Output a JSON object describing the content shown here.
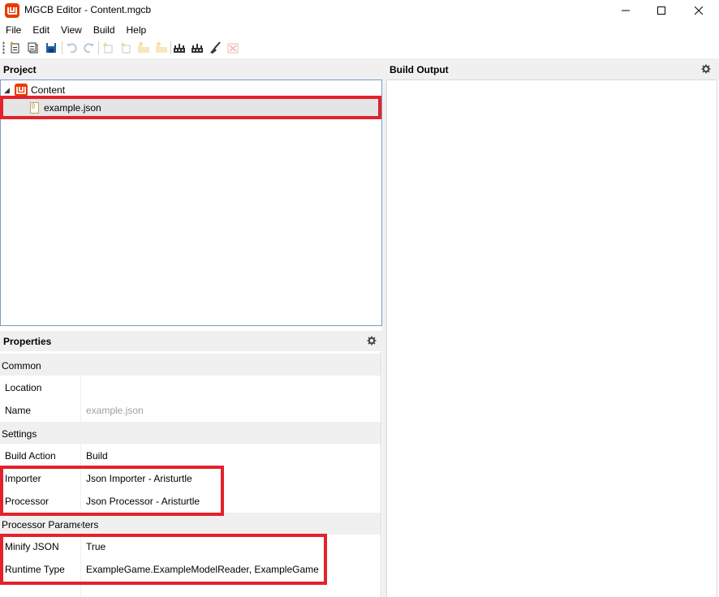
{
  "window": {
    "title": "MGCB Editor - Content.mgcb",
    "logo": "monogame-logo",
    "controls": {
      "minimize": "—",
      "maximize": "☐",
      "close": "✕"
    }
  },
  "menu": [
    "File",
    "Edit",
    "View",
    "Build",
    "Help"
  ],
  "toolbar": {
    "buttons": [
      {
        "name": "new-icon",
        "enabled": true
      },
      {
        "name": "open-icon",
        "enabled": true
      },
      {
        "name": "save-icon",
        "enabled": true
      },
      {
        "name": "undo-icon",
        "enabled": false
      },
      {
        "name": "redo-icon",
        "enabled": false
      },
      {
        "name": "add-new-item-icon",
        "enabled": false
      },
      {
        "name": "add-existing-item-icon",
        "enabled": false
      },
      {
        "name": "add-new-folder-icon",
        "enabled": false
      },
      {
        "name": "add-existing-folder-icon",
        "enabled": false
      },
      {
        "name": "build-icon",
        "enabled": true
      },
      {
        "name": "rebuild-icon",
        "enabled": true
      },
      {
        "name": "clean-icon",
        "enabled": true
      },
      {
        "name": "cancel-build-icon",
        "enabled": false
      }
    ]
  },
  "project": {
    "header": "Project",
    "root_label": "Content",
    "items": [
      {
        "label": "example.json",
        "icon": "json-file-icon",
        "selected": true
      }
    ]
  },
  "build_output": {
    "header": "Build Output"
  },
  "properties": {
    "header": "Properties",
    "categories": [
      {
        "label": "Common",
        "rows": [
          {
            "name": "Location",
            "value": ""
          },
          {
            "name": "Name",
            "value": "example.json",
            "disabled": true
          }
        ]
      },
      {
        "label": "Settings",
        "rows": [
          {
            "name": "Build Action",
            "value": "Build"
          },
          {
            "name": "Importer",
            "value": "Json Importer - Aristurtle"
          },
          {
            "name": "Processor",
            "value": "Json Processor - Aristurtle"
          }
        ]
      },
      {
        "label": "Processor Parameters",
        "rows": [
          {
            "name": "Minify JSON",
            "value": "True"
          },
          {
            "name": "Runtime Type",
            "value": "ExampleGame.ExampleModelReader, ExampleGame"
          }
        ]
      }
    ]
  },
  "colors": {
    "highlight": "#e3222c",
    "logo": "#e73c00",
    "pane_header_bg": "#f0f0f0",
    "selected_row_bg": "#e5e5e5"
  }
}
